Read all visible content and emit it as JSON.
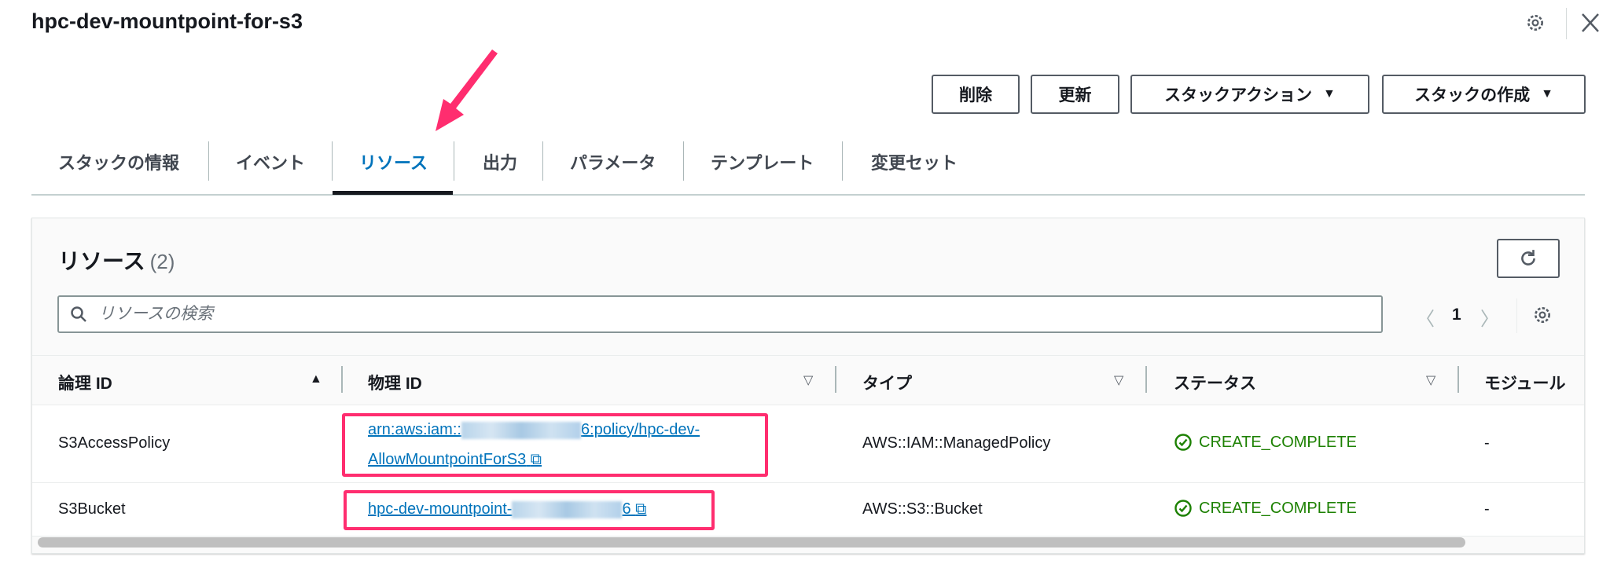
{
  "header": {
    "title": "hpc-dev-mountpoint-for-s3"
  },
  "actions": {
    "delete": "削除",
    "update": "更新",
    "stack_actions": "スタックアクション",
    "create_stack": "スタックの作成"
  },
  "tabs": [
    {
      "label": "スタックの情報"
    },
    {
      "label": "イベント"
    },
    {
      "label": "リソース"
    },
    {
      "label": "出力"
    },
    {
      "label": "パラメータ"
    },
    {
      "label": "テンプレート"
    },
    {
      "label": "変更セット"
    }
  ],
  "resources": {
    "title": "リソース",
    "count": "(2)",
    "search_placeholder": "リソースの検索",
    "page": "1",
    "columns": [
      "論理 ID",
      "物理 ID",
      "タイプ",
      "ステータス",
      "モジュール"
    ],
    "rows": [
      {
        "logical_id": "S3AccessPolicy",
        "physical_prefix": "arn:aws:iam::",
        "physical_suffix": "6:policy/hpc-dev-",
        "physical_line2": "AllowMountpointForS3",
        "type": "AWS::IAM::ManagedPolicy",
        "status": "CREATE_COMPLETE",
        "module": "-"
      },
      {
        "logical_id": "S3Bucket",
        "physical_prefix": "hpc-dev-mountpoint-",
        "physical_suffix": "6",
        "type": "AWS::S3::Bucket",
        "status": "CREATE_COMPLETE",
        "module": "-"
      }
    ]
  },
  "colors": {
    "accent": "#0073bb",
    "success": "#1d8102",
    "highlight": "#ff2d6f"
  }
}
